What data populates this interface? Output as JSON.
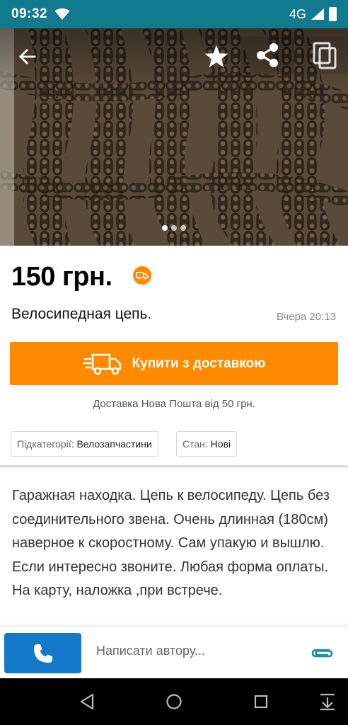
{
  "status_bar": {
    "time": "09:32",
    "network": "4G"
  },
  "photo": {
    "pager_dots": 3,
    "active_dot": 1
  },
  "listing": {
    "price": "150 грн.",
    "title": "Велосипедная цепь.",
    "date": "Вчера 20:13",
    "buy_button_label": "Купити з доставкою",
    "delivery_note": "Доставка Нова Пошта від 50 грн.",
    "subcategory_key": "Підкатегорії:",
    "subcategory_value": "Велозапчастини",
    "state_key": "Стан:",
    "state_value": "Нові",
    "description": "Гаражная находка. Цепь к  велосипеду. Цепь без соединительного звена. Очень длинная (180см)  наверное к  скоростному. Сам упакую и вышлю. Если интересно звоните. Любая форма оплаты. На карту, наложка ,при встрече."
  },
  "contact_bar": {
    "message_placeholder": "Написати автору..."
  },
  "colors": {
    "status_bar": "#127a8e",
    "accent_orange": "#ff8a00",
    "call_blue": "#1478c9",
    "attach_teal": "#1a8fa6"
  },
  "icons": {
    "back": "arrow-left-icon",
    "favorite": "star-icon",
    "share": "share-icon",
    "copy": "copy-icon",
    "delivery": "truck-icon",
    "call": "phone-icon",
    "attach": "paperclip-icon"
  }
}
